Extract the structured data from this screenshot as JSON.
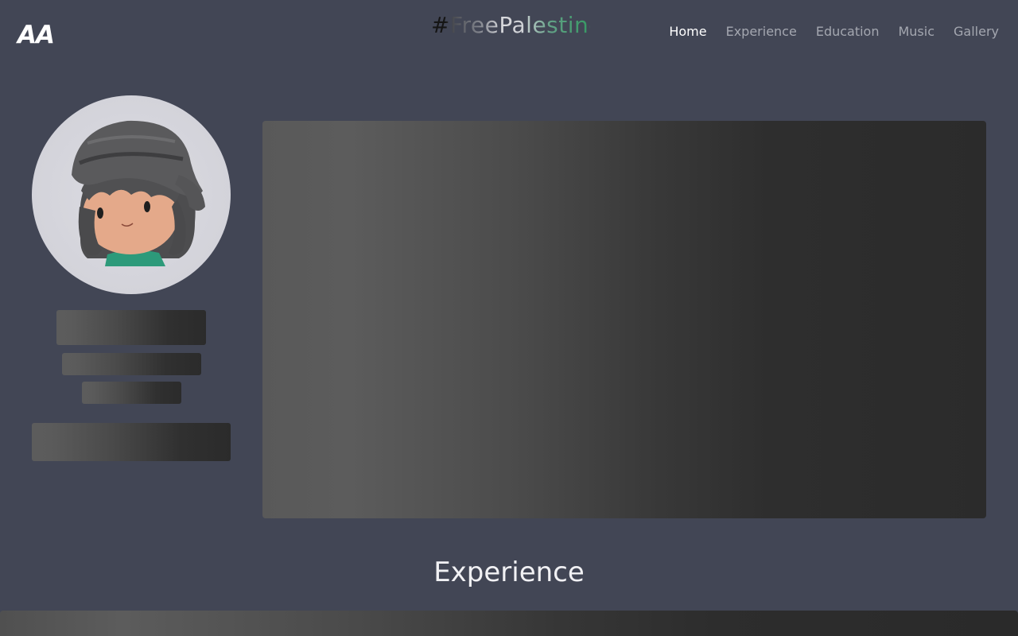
{
  "header": {
    "logo_text": "AA",
    "hashtag": "#FreePalestine",
    "nav": [
      {
        "label": "Home",
        "active": true
      },
      {
        "label": "Experience",
        "active": false
      },
      {
        "label": "Education",
        "active": false
      },
      {
        "label": "Music",
        "active": false
      },
      {
        "label": "Gallery",
        "active": false
      }
    ]
  },
  "profile": {
    "avatar": "cartoon-avatar-with-hat"
  },
  "sections": {
    "experience_title": "Experience"
  },
  "colors": {
    "background": "#424655",
    "nav_active": "#ffffff",
    "nav_inactive": "#a4a7b0",
    "hashtag_gradient": [
      "#151515",
      "#d8d9dd",
      "#3a9a66"
    ]
  }
}
